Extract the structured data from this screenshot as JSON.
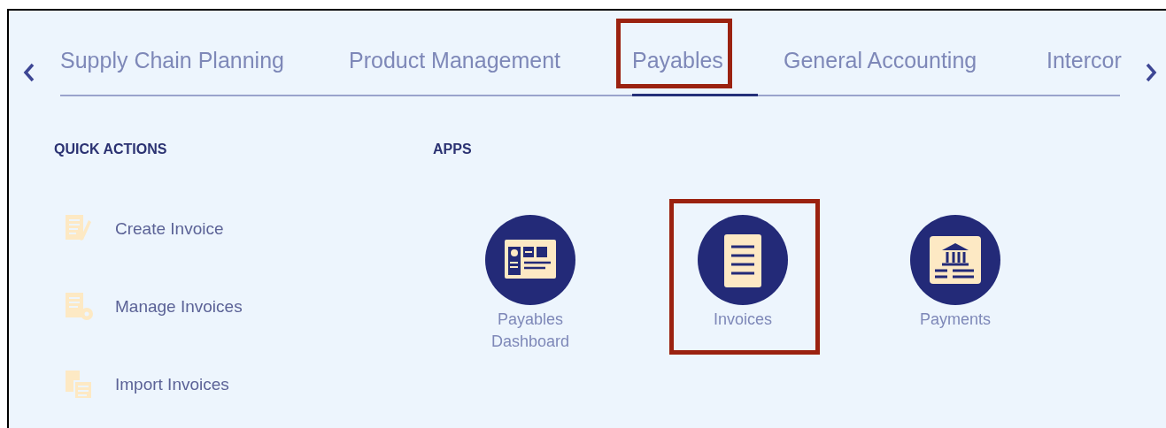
{
  "tabs": [
    {
      "label": "Supply Chain Planning",
      "selected": false,
      "highlighted": false
    },
    {
      "label": "Product Management",
      "selected": false,
      "highlighted": false
    },
    {
      "label": "Payables",
      "selected": true,
      "highlighted": true
    },
    {
      "label": "General Accounting",
      "selected": false,
      "highlighted": false
    },
    {
      "label": "Intercor",
      "selected": false,
      "highlighted": false
    }
  ],
  "quick_actions": {
    "heading": "QUICK ACTIONS",
    "items": [
      {
        "kind": "create",
        "label": "Create Invoice"
      },
      {
        "kind": "manage",
        "label": "Manage Invoices"
      },
      {
        "kind": "import",
        "label": "Import Invoices"
      }
    ]
  },
  "apps": {
    "heading": "APPS",
    "items": [
      {
        "kind": "dashboard",
        "label": "Payables Dashboard",
        "highlighted": false
      },
      {
        "kind": "invoices",
        "label": "Invoices",
        "highlighted": true
      },
      {
        "kind": "payments",
        "label": "Payments",
        "highlighted": false
      }
    ]
  }
}
